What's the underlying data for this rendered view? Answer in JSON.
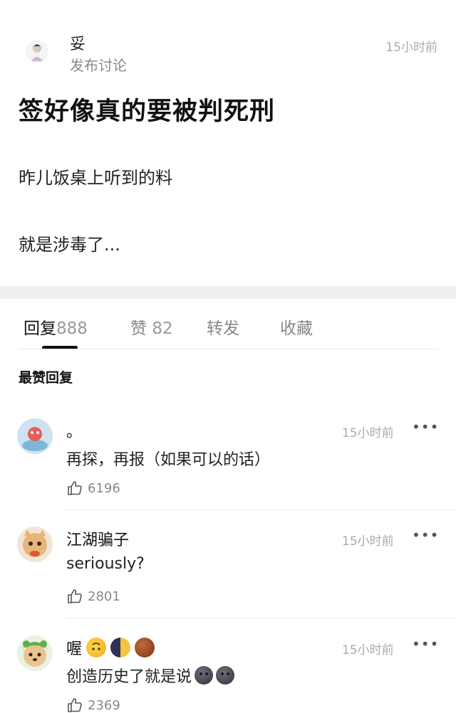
{
  "post": {
    "author": "妥",
    "action": "发布讨论",
    "time": "15小时前",
    "title": "签好像真的要被判死刑",
    "body_line1": "昨儿饭桌上听到的料",
    "body_line2": "就是涉毒了..."
  },
  "tabs": [
    {
      "label": "回复",
      "count": "888",
      "active": true
    },
    {
      "label": "赞",
      "count": "82",
      "active": false
    },
    {
      "label": "转发",
      "count": "",
      "active": false
    },
    {
      "label": "收藏",
      "count": "",
      "active": false
    }
  ],
  "section_title": "最赞回复",
  "comments": [
    {
      "name": "。",
      "time": "15小时前",
      "more": "•••",
      "text": "再探，再报（如果可以的话）",
      "likes": "6196"
    },
    {
      "name": "江湖骗子",
      "time": "15小时前",
      "more": "•••",
      "text": "seriously?",
      "likes": "2801"
    },
    {
      "name": "喔",
      "time": "15小时前",
      "more": "•••",
      "text": "创造历史了就是说",
      "likes": "2369"
    }
  ],
  "icons": {
    "like": "thumbs-up-icon",
    "more": "more-dots-icon",
    "name_emojis": [
      "upside-down-face-emoji",
      "crescent-moon-face-emoji",
      "chestnut-emoji"
    ],
    "text_emojis": [
      "new-moon-face-emoji",
      "new-moon-face-emoji"
    ]
  },
  "colors": {
    "text_primary": "#111111",
    "text_secondary": "#888888",
    "time": "#aaaaaa",
    "band": "#efefef"
  }
}
